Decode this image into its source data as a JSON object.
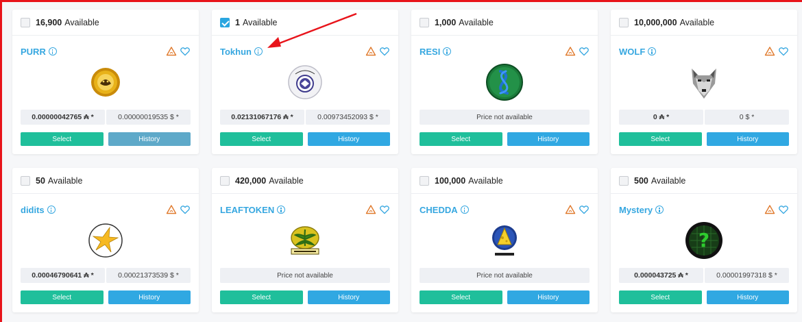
{
  "colors": {
    "accent": "#36a7e0",
    "select_button": "#1fbf9b",
    "history_button": "#30a8e2",
    "highlight_frame": "#e8141b"
  },
  "cards": [
    {
      "available_count": "16,900",
      "available_label": "Available",
      "checked": false,
      "name": "PURR",
      "icon": "purr-token-logo",
      "price_available": true,
      "price_native": "0.00000042765 ₳ *",
      "price_usd": "0.00000019535 $ *",
      "select_label": "Select",
      "history_label": "History",
      "history_state": "hover"
    },
    {
      "available_count": "1",
      "available_label": "Available",
      "checked": true,
      "name": "Tokhun",
      "icon": "tokhun-token-logo",
      "price_available": true,
      "price_native": "0.02131067176 ₳ *",
      "price_usd": "0.00973452093 $ *",
      "select_label": "Select",
      "history_label": "History"
    },
    {
      "available_count": "1,000",
      "available_label": "Available",
      "checked": false,
      "name": "RESI",
      "icon": "resi-token-logo",
      "price_available": false,
      "price_na": "Price not available",
      "select_label": "Select",
      "history_label": "History"
    },
    {
      "available_count": "10,000,000",
      "available_label": "Available",
      "checked": false,
      "name": "WOLF",
      "icon": "wolf-token-logo",
      "price_available": true,
      "price_native": "0 ₳ *",
      "price_usd": "0 $ *",
      "select_label": "Select",
      "history_label": "History"
    },
    {
      "available_count": "50",
      "available_label": "Available",
      "checked": false,
      "name": "didits",
      "icon": "didits-token-logo",
      "price_available": true,
      "price_native": "0.00046790641 ₳ *",
      "price_usd": "0.00021373539 $ *",
      "select_label": "Select",
      "history_label": "History"
    },
    {
      "available_count": "420,000",
      "available_label": "Available",
      "checked": false,
      "name": "LEAFTOKEN",
      "icon": "leaftoken-token-logo",
      "price_available": false,
      "price_na": "Price not available",
      "select_label": "Select",
      "history_label": "History"
    },
    {
      "available_count": "100,000",
      "available_label": "Available",
      "checked": false,
      "name": "CHEDDA",
      "icon": "chedda-token-logo",
      "price_available": false,
      "price_na": "Price not available",
      "select_label": "Select",
      "history_label": "History"
    },
    {
      "available_count": "500",
      "available_label": "Available",
      "checked": false,
      "name": "Mystery",
      "icon": "mystery-token-logo",
      "price_available": true,
      "price_native": "0.000043725 ₳ *",
      "price_usd": "0.00001997318 $ *",
      "select_label": "Select",
      "history_label": "History"
    }
  ]
}
